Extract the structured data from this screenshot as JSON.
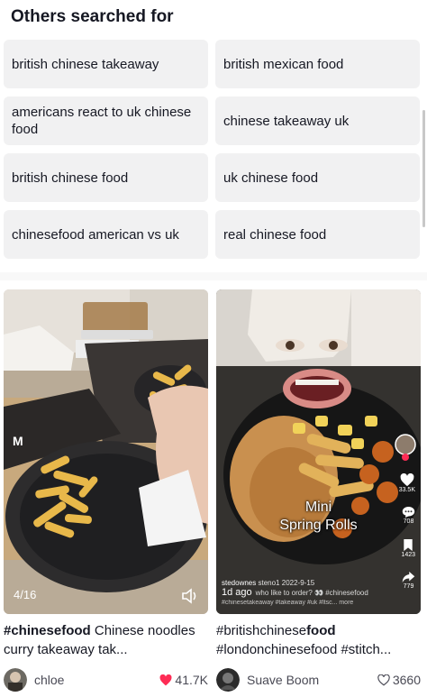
{
  "section": {
    "title": "Others searched for"
  },
  "searches": [
    "british chinese takeaway",
    "british mexican food",
    "americans react to uk chinese food",
    "chinese takeaway uk",
    "british chinese food",
    "uk chinese food",
    "chinesefood american vs uk",
    "real chinese food"
  ],
  "videos": [
    {
      "page_indicator": "4/16",
      "caption_tag": "#chinesefood",
      "caption_rest": " Chinese noodles curry takeaway tak...",
      "author": "chloe",
      "likes": "41.7K",
      "liked": true
    },
    {
      "overlay_title_1": "Mini",
      "overlay_title_2": "Spring Rolls",
      "overlay_user": "stedownes",
      "overlay_tag": "steno1",
      "overlay_date": "2022-9-15",
      "overlay_time": "1d ago",
      "overlay_desc": "who like to order? 👀 #chinesefood",
      "overlay_desc2": "#chinesetakeaway #takeaway #uk #ltsc... more",
      "side_counts": [
        "33.5K",
        "708",
        "1423",
        "779"
      ],
      "caption_prefix": "#british",
      "caption_tag_mid": "chinese",
      "caption_bold": "food",
      "caption_line2": "#londonchinesefood #stitch...",
      "author": "Suave Boom",
      "likes": "3660",
      "liked": false
    }
  ],
  "colors": {
    "chip_bg": "#f1f1f2",
    "like_red": "#fe2c55",
    "text": "#161823"
  }
}
